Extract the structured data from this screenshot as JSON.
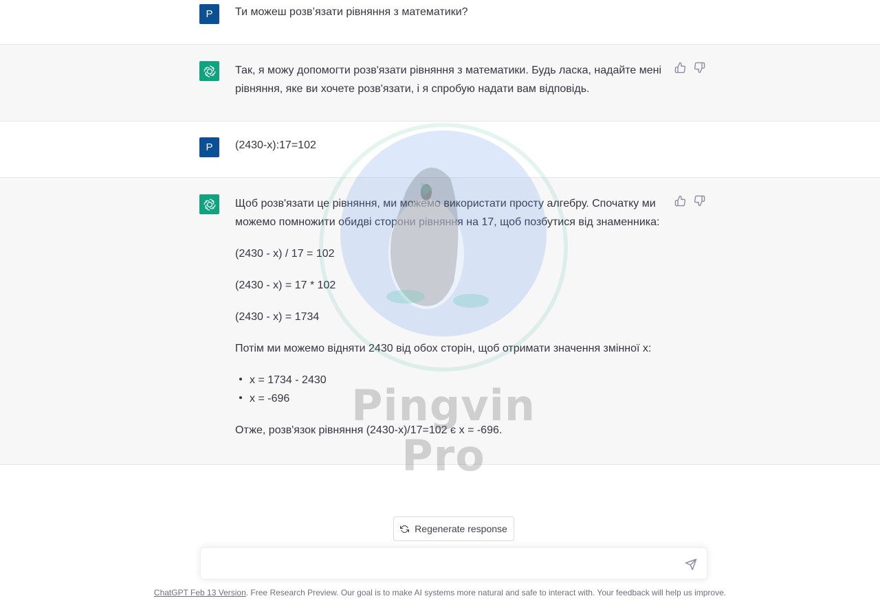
{
  "conversation": [
    {
      "role": "user",
      "avatar_letter": "P",
      "text": "Ти можеш розв’язати рівняння з математики?"
    },
    {
      "role": "assistant",
      "lines": [
        "Так, я можу допомогти розв'язати рівняння з математики. Будь ласка, надайте мені рівняння, яке ви хочете розв'язати, і я спробую надати вам відповідь."
      ]
    },
    {
      "role": "user",
      "avatar_letter": "P",
      "text": "(2430-x):17=102"
    },
    {
      "role": "assistant",
      "intro": "Щоб розв'язати це рівняння, ми можемо використати просту алгебру. Спочатку ми можемо помножити обидві сторони рівняння на 17, щоб позбутися від знаменника:",
      "step1": "(2430 - x) / 17 = 102",
      "step2": "(2430 - x) = 17 * 102",
      "step3": "(2430 - x) = 1734",
      "then": "Потім ми можемо відняти 2430 від обох сторін, щоб отримати значення змінної x:",
      "bullets": [
        "x = 1734 - 2430",
        "x = -696"
      ],
      "conclusion": "Отже, розв'язок рівняння (2430-x)/17=102 є x = -696."
    }
  ],
  "controls": {
    "regenerate_label": "Regenerate response",
    "input_placeholder": "",
    "send_icon": "send-icon"
  },
  "footer": {
    "link_text": "ChatGPT Feb 13 Version",
    "rest_text": ". Free Research Preview. Our goal is to make AI systems more natural and safe to interact with. Your feedback will help us improve."
  },
  "watermark": {
    "text": "Pingvin Pro"
  },
  "colors": {
    "user_avatar": "#0b4f94",
    "bot_avatar": "#10a37f",
    "bot_row_bg": "#f7f7f8"
  }
}
